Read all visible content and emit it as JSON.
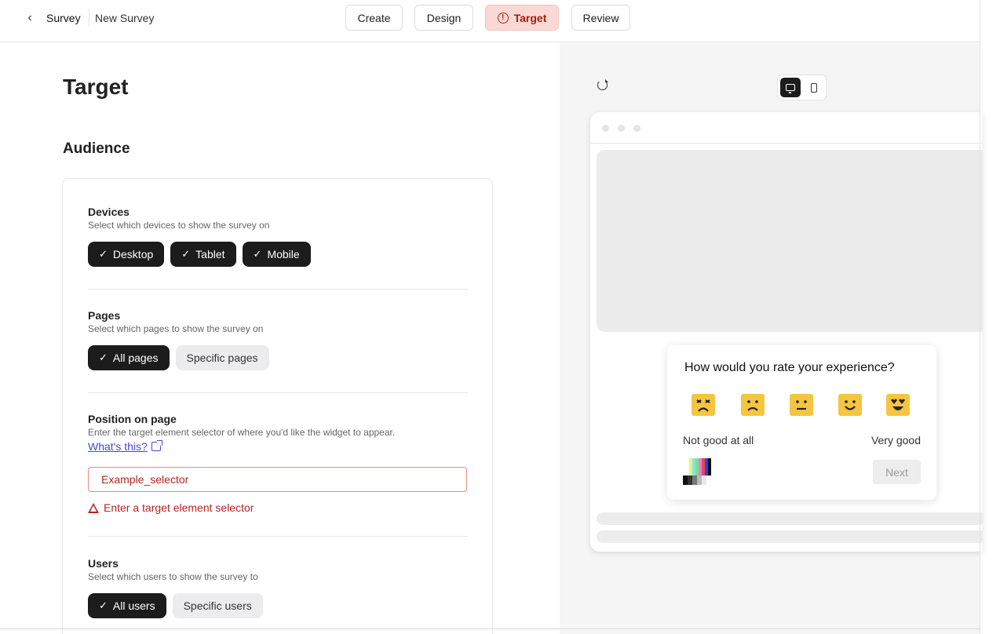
{
  "header": {
    "back_label": "‹",
    "breadcrumb_root": "Survey",
    "survey_name": "New Survey",
    "tabs": [
      {
        "label": "Create"
      },
      {
        "label": "Design"
      },
      {
        "label": "Target"
      },
      {
        "label": "Review"
      }
    ]
  },
  "main": {
    "title": "Target",
    "section_title": "Audience",
    "devices": {
      "title": "Devices",
      "description": "Select which devices to show the survey on",
      "options": [
        "Desktop",
        "Tablet",
        "Mobile"
      ]
    },
    "pages": {
      "title": "Pages",
      "description": "Select which pages to show the survey on",
      "selected": "All pages",
      "other": "Specific pages"
    },
    "position": {
      "title": "Position on page",
      "description": "Enter the target element selector of where you'd like the widget to appear.",
      "help_link": "What's this?",
      "input_value": "Example_selector",
      "error": "Enter a target element selector"
    },
    "users": {
      "title": "Users",
      "description": "Select which users to show the survey to",
      "selected": "All users",
      "other": "Specific users"
    }
  },
  "preview": {
    "question": "How would you rate your experience?",
    "scale_low": "Not good at all",
    "scale_high": "Very good",
    "next_label": "Next",
    "emoji_color": "#f5c542"
  },
  "colors": {
    "active_tab_bg": "#fad9d4",
    "error": "#b3261e",
    "link": "#4a46d8",
    "chip_on": "#1c1c1c"
  }
}
